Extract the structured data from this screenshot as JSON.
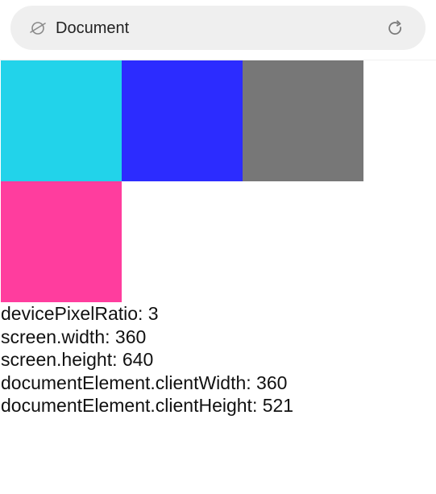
{
  "addressbar": {
    "title": "Document",
    "left_icon": "planet-icon",
    "right_icon": "reload-icon"
  },
  "boxes": [
    {
      "color": "#22d3ea"
    },
    {
      "color": "#2c2cff"
    },
    {
      "color": "#777777"
    },
    {
      "color": "#ff3d9e"
    }
  ],
  "info": {
    "lines": [
      "devicePixelRatio: 3",
      "screen.width: 360",
      "screen.height: 640",
      "documentElement.clientWidth: 360",
      "documentElement.clientHeight: 521"
    ]
  }
}
